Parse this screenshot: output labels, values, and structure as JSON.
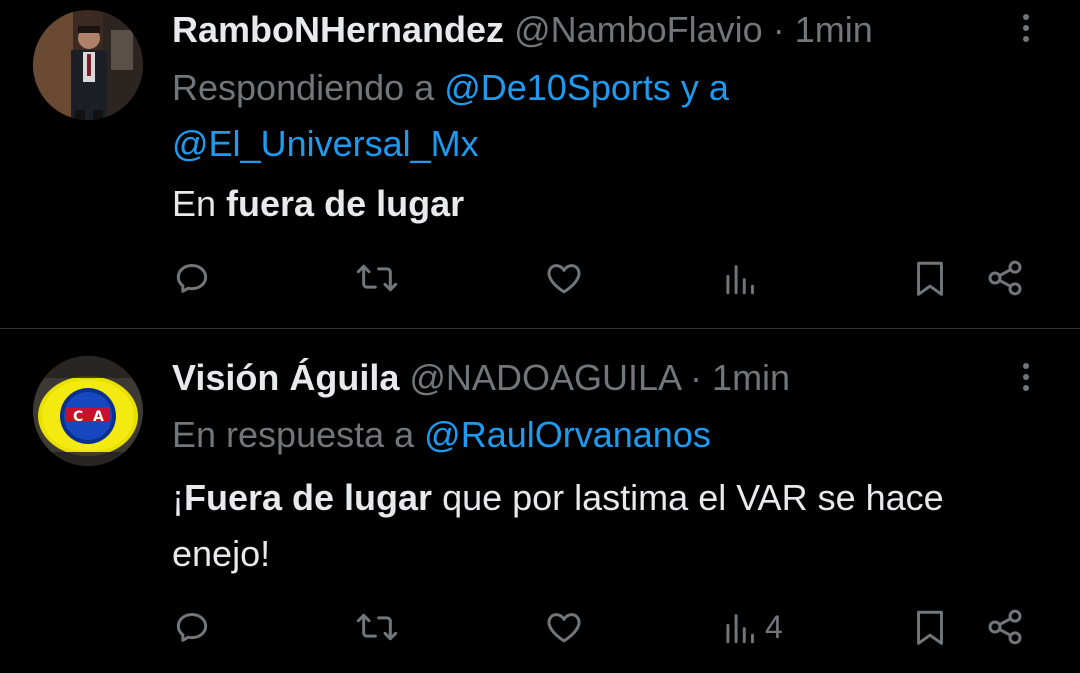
{
  "tweets": [
    {
      "display_name": "RamboNHernandez",
      "handle": "@NamboFlavio",
      "separator": "·",
      "time": "1min",
      "reply_prefix": "Respondiendo a ",
      "reply_mention_1": "@De10Sports",
      "reply_joiner": " y a",
      "reply_mention_2": "@El_Universal_Mx",
      "body_plain_1": "En ",
      "body_bold": "fuera de lugar",
      "body_plain_2": "",
      "views_count": "",
      "avatar_icon": "person-photo-avatar"
    },
    {
      "display_name": "Visión Águila",
      "handle": "@NADOAGUILA",
      "separator": "·",
      "time": "1min",
      "reply_prefix": "En respuesta a ",
      "reply_mention_1": "@RaulOrvananos",
      "body_plain_1": "¡",
      "body_bold": "Fuera de lugar",
      "body_plain_2": " que por lastima el VAR se hace enejo!",
      "views_count": "4",
      "avatar_icon": "club-america-crest-avatar"
    }
  ],
  "icons": {
    "reply": "reply-icon",
    "retweet": "retweet-icon",
    "like": "heart-icon",
    "views": "views-bar-chart-icon",
    "bookmark": "bookmark-icon",
    "share": "share-icon",
    "more": "more-vertical-icon"
  },
  "colors": {
    "background": "#000000",
    "text_primary": "#e7e9ea",
    "text_secondary": "#71767b",
    "link": "#1d9bf0",
    "divider": "#2f3336"
  }
}
